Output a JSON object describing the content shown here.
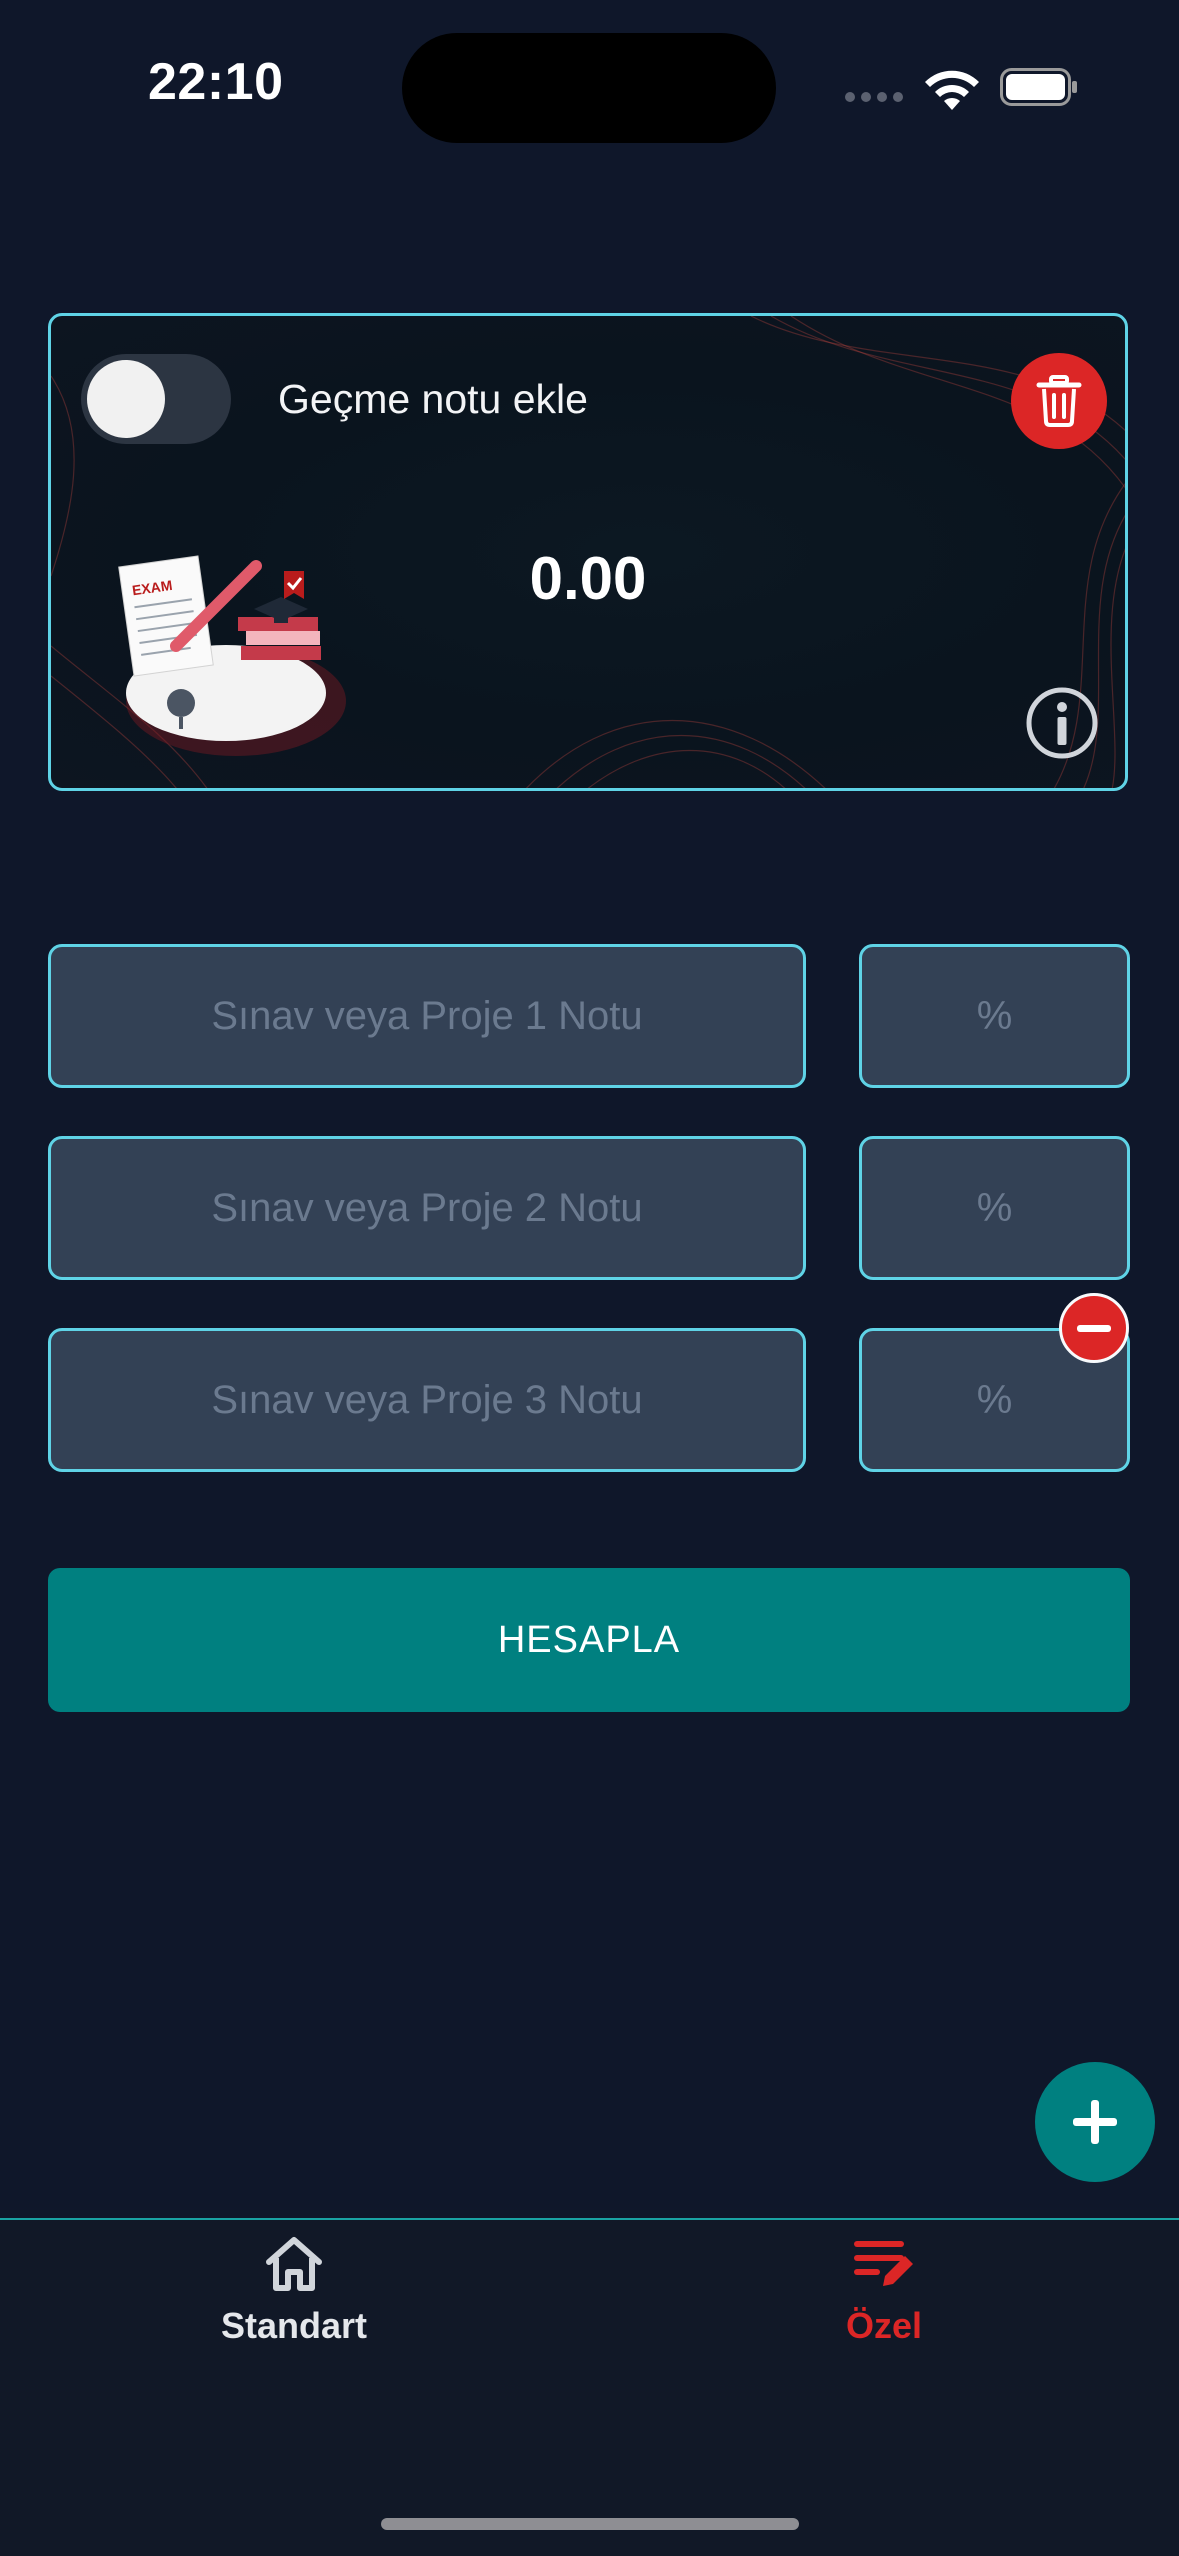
{
  "status_bar": {
    "time": "22:10"
  },
  "card": {
    "toggle_label": "Geçme notu ekle",
    "toggle_on": false,
    "result": "0.00"
  },
  "rows": [
    {
      "grade_placeholder": "Sınav veya Proje  1 Notu",
      "percent_placeholder": "%"
    },
    {
      "grade_placeholder": "Sınav veya Proje  2 Notu",
      "percent_placeholder": "%"
    },
    {
      "grade_placeholder": "Sınav veya Proje  3 Notu",
      "percent_placeholder": "%"
    }
  ],
  "calculate_label": "HESAPLA",
  "tabs": [
    {
      "label": "Standart",
      "icon": "home-icon",
      "active": false
    },
    {
      "label": "Özel",
      "icon": "edit-list-icon",
      "active": true
    }
  ],
  "colors": {
    "accent": "#008080",
    "danger": "#dc2626",
    "border": "#5fd3e6",
    "background": "#0f172a",
    "active_tab": "#dc2626"
  }
}
